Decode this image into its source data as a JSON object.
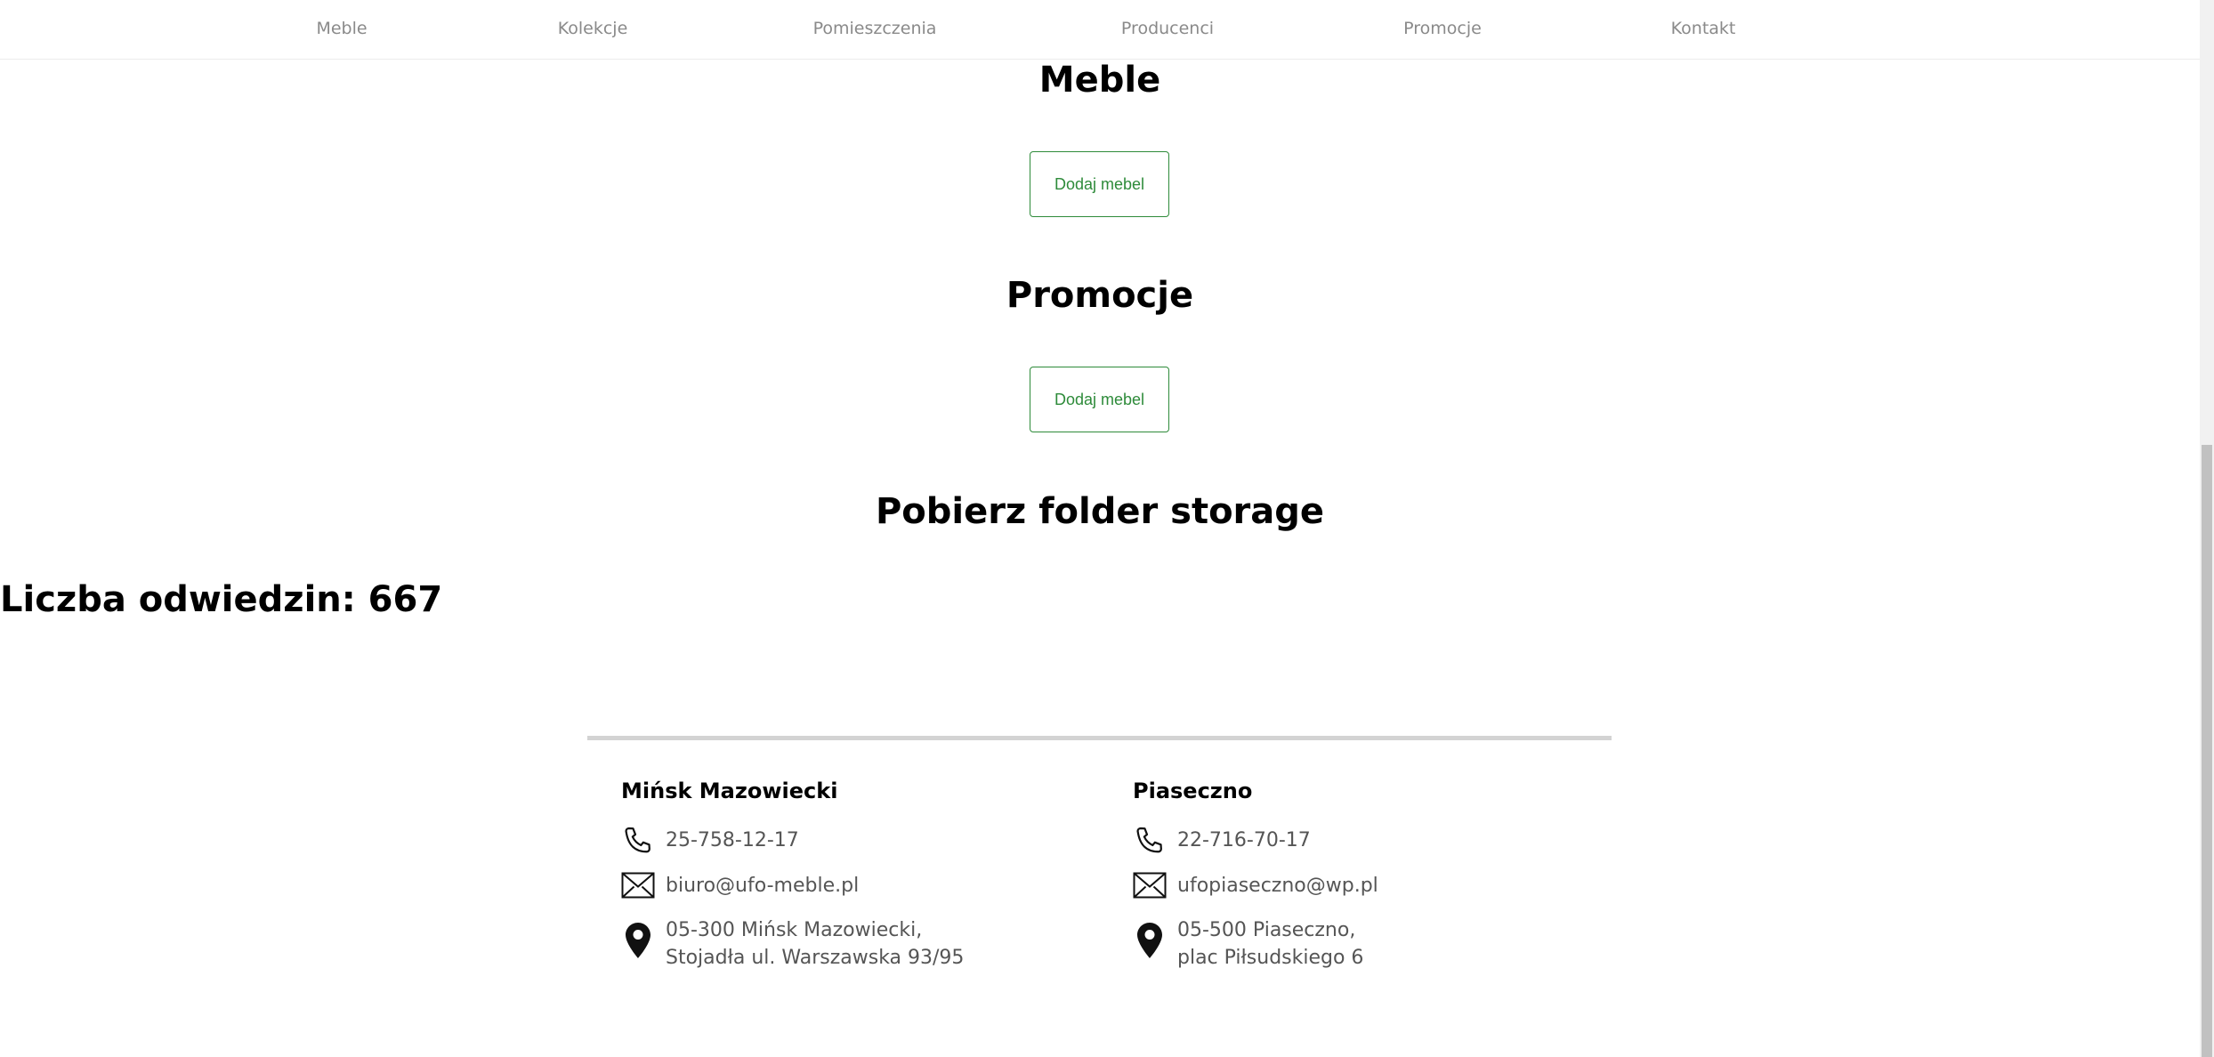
{
  "nav": {
    "items": [
      "Meble",
      "Kolekcje",
      "Pomieszczenia",
      "Producenci",
      "Promocje",
      "Kontakt"
    ]
  },
  "sections": {
    "meble": {
      "title": "Meble",
      "button_label": "Dodaj mebel"
    },
    "promocje": {
      "title": "Promocje",
      "button_label": "Dodaj mebel"
    },
    "folder": {
      "title": "Pobierz folder storage"
    }
  },
  "visits": {
    "label": "Liczba odwiedzin: 667"
  },
  "footer": {
    "locations": [
      {
        "city": "Mińsk Mazowiecki",
        "phone": "25-758-12-17",
        "email": "biuro@ufo-meble.pl",
        "address_line1": "05-300 Mińsk Mazowiecki,",
        "address_line2": "Stojadła ul. Warszawska 93/95"
      },
      {
        "city": "Piaseczno",
        "phone": "22-716-70-17",
        "email": "ufopiaseczno@wp.pl",
        "address_line1": "05-500 Piaseczno,",
        "address_line2": "plac Piłsudskiego 6"
      }
    ]
  },
  "colors": {
    "accent_green": "#2e8b3a",
    "nav_text": "#8a8a8a",
    "footer_rule": "#d3d3d3"
  },
  "icons": [
    "phone-icon",
    "envelope-icon",
    "map-pin-icon"
  ]
}
